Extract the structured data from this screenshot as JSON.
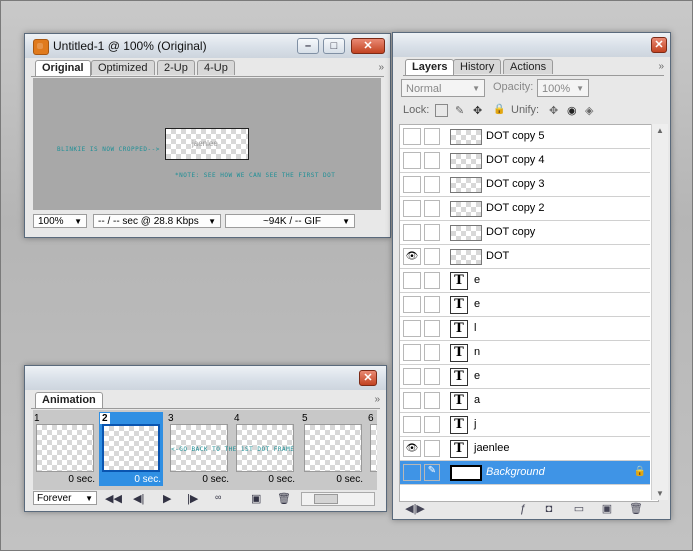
{
  "doc": {
    "title": "Untitled-1 @ 100% (Original)",
    "tabs": [
      "Original",
      "Optimized",
      "2-Up",
      "4-Up"
    ],
    "canvas_label_left": "BLINKIE IS NOW CROPPED-->",
    "canvas_note": "*NOTE: SEE HOW WE CAN SEE THE FIRST DOT",
    "blinkie_text": "jaenlee",
    "zoom": "100%",
    "speed": "-- / -- sec @ 28.8 Kbps",
    "size": "~94K / -- GIF"
  },
  "animation": {
    "tab": "Animation",
    "frames": [
      {
        "num": "1",
        "delay": "0 sec."
      },
      {
        "num": "2",
        "delay": "0 sec."
      },
      {
        "num": "3",
        "delay": "0 sec."
      },
      {
        "num": "4",
        "delay": "0 sec."
      },
      {
        "num": "5",
        "delay": "0 sec."
      },
      {
        "num": "6",
        "delay": ""
      }
    ],
    "overlay_text": "<-GO BACK TO THE 1ST DOT FRAME",
    "loop": "Forever"
  },
  "layers_panel": {
    "tabs": [
      "Layers",
      "History",
      "Actions"
    ],
    "blend_mode": "Normal",
    "opacity_label": "Opacity:",
    "opacity_value": "100%",
    "lock_label": "Lock:",
    "unify_label": "Unify:",
    "layers": [
      {
        "name": "DOT copy 5",
        "type": "image",
        "visible": false
      },
      {
        "name": "DOT copy 4",
        "type": "image",
        "visible": false
      },
      {
        "name": "DOT copy 3",
        "type": "image",
        "visible": false
      },
      {
        "name": "DOT copy 2",
        "type": "image",
        "visible": false
      },
      {
        "name": "DOT copy",
        "type": "image",
        "visible": false
      },
      {
        "name": "DOT",
        "type": "image",
        "visible": true
      },
      {
        "name": "e",
        "type": "text",
        "visible": false
      },
      {
        "name": "e",
        "type": "text",
        "visible": false
      },
      {
        "name": "l",
        "type": "text",
        "visible": false
      },
      {
        "name": "n",
        "type": "text",
        "visible": false
      },
      {
        "name": "e",
        "type": "text",
        "visible": false
      },
      {
        "name": "a",
        "type": "text",
        "visible": false
      },
      {
        "name": "j",
        "type": "text",
        "visible": false
      },
      {
        "name": "jaenlee",
        "type": "text",
        "visible": true
      },
      {
        "name": "Background",
        "type": "background",
        "visible": false
      }
    ]
  },
  "icons": {
    "eye": "👁",
    "text_layer": "T",
    "lock": "🔒",
    "flyout": "»",
    "play": "▶",
    "first": "◀◀",
    "prev": "◀|",
    "next": "|▶",
    "trash": "🗑",
    "dropdown": "▼"
  }
}
